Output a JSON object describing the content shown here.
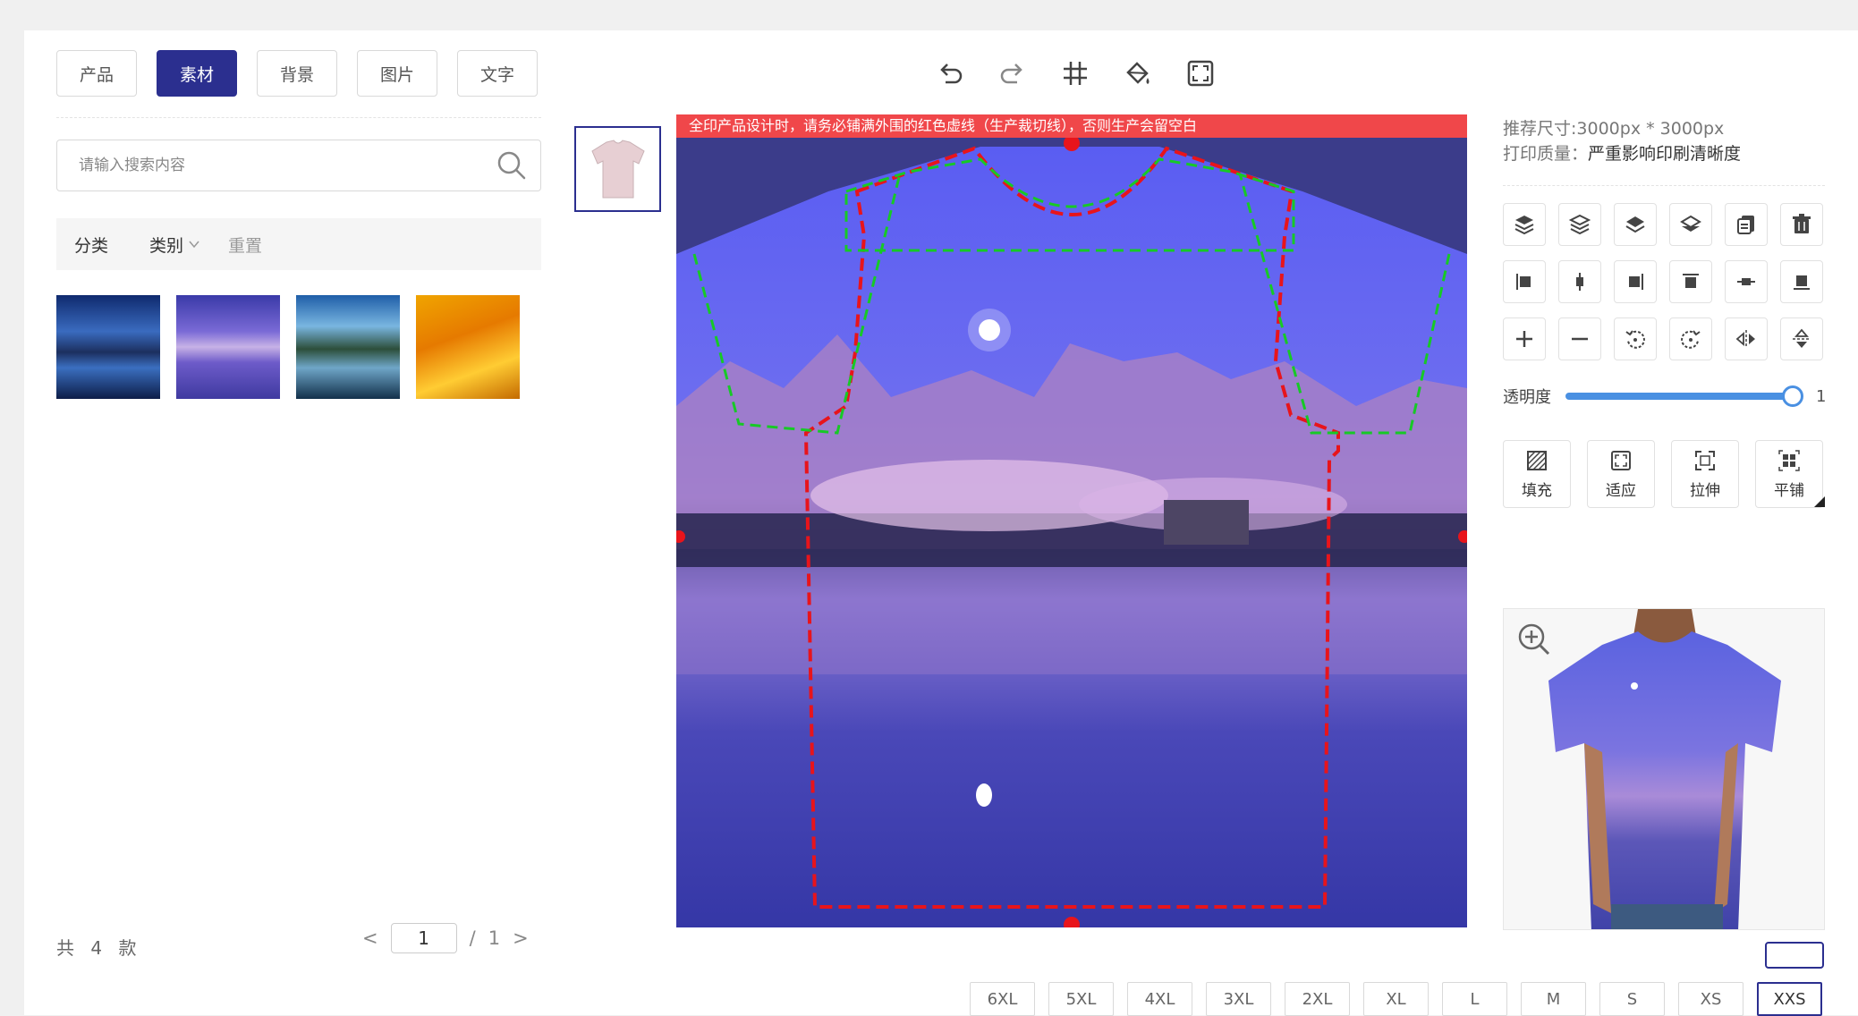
{
  "tabs": [
    {
      "label": "产品",
      "active": false
    },
    {
      "label": "素材",
      "active": true
    },
    {
      "label": "背景",
      "active": false
    },
    {
      "label": "图片",
      "active": false
    },
    {
      "label": "文字",
      "active": false
    }
  ],
  "search": {
    "placeholder": "请输入搜索内容"
  },
  "filter": {
    "category_label": "分类",
    "type_label": "类别",
    "reset_label": "重置"
  },
  "materials_count": "共 4 款",
  "pagination": {
    "current": "1",
    "separator": "/",
    "total": "1",
    "prev": "<",
    "next": ">"
  },
  "canvas": {
    "warning": "全印产品设计时，请务必铺满外围的红色虚线（生产裁切线），否则生产会留空白"
  },
  "info": {
    "recommended_size": "推荐尺寸:3000px * 3000px",
    "print_quality_label": "打印质量：",
    "print_quality_value": "严重影响印刷清晰度"
  },
  "opacity": {
    "label": "透明度",
    "value": "1",
    "level": 1.0
  },
  "fit_buttons": [
    {
      "label": "填充",
      "icon": "fill-pattern-icon"
    },
    {
      "label": "适应",
      "icon": "fit-frame-icon"
    },
    {
      "label": "拉伸",
      "icon": "stretch-icon"
    },
    {
      "label": "平铺",
      "icon": "tile-icon"
    }
  ],
  "sizes": [
    "6XL",
    "5XL",
    "4XL",
    "3XL",
    "2XL",
    "XL",
    "L",
    "M",
    "S",
    "XS",
    "XXS"
  ],
  "selected_size": "XXS",
  "colors": {
    "accent": "#2b2f8f",
    "warning": "#f0474a",
    "slider": "#4a90e2"
  }
}
